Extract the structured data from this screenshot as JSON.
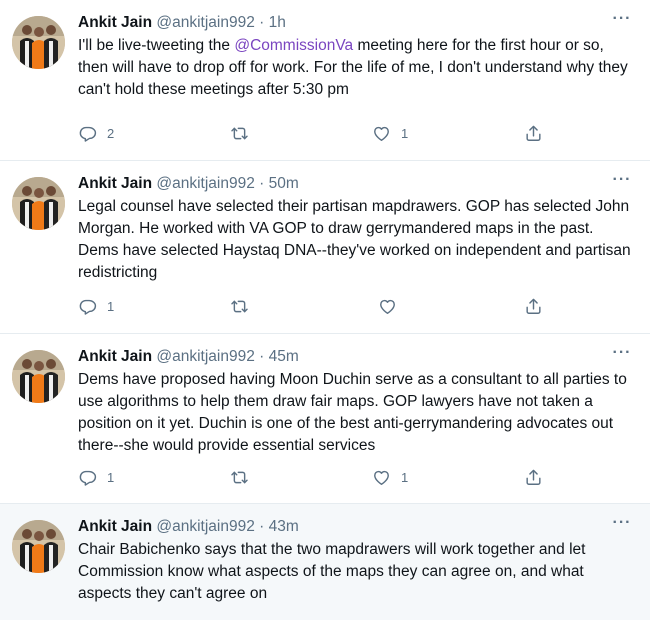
{
  "tweets": [
    {
      "name": "Ankit Jain",
      "handle": "@ankitjain992",
      "separator": "·",
      "time": "1h",
      "text_before": "I'll be live-tweeting the ",
      "mention": "@CommissionVa",
      "text_after": " meeting here for the first hour or so, then will have to drop off for work. For the life of me, I don't understand why they can't hold these meetings after 5:30 pm",
      "replies": "2",
      "retweets": "",
      "likes": "1"
    },
    {
      "name": "Ankit Jain",
      "handle": "@ankitjain992",
      "separator": "·",
      "time": "50m",
      "text": "Legal counsel have selected their partisan mapdrawers. GOP has selected John Morgan. He worked with VA GOP to draw gerrymandered maps in the past. Dems have selected Haystaq DNA--they've worked on independent and partisan redistricting",
      "replies": "1",
      "retweets": "",
      "likes": ""
    },
    {
      "name": "Ankit Jain",
      "handle": "@ankitjain992",
      "separator": "·",
      "time": "45m",
      "text": "Dems have proposed having Moon Duchin serve as a consultant to all parties to use algorithms to help them draw fair maps. GOP lawyers have not taken a position on it yet. Duchin is one of the best anti-gerrymandering advocates out there--she would provide essential services",
      "replies": "1",
      "retweets": "",
      "likes": "1"
    },
    {
      "name": "Ankit Jain",
      "handle": "@ankitjain992",
      "separator": "·",
      "time": "43m",
      "text": "Chair Babichenko says that the two mapdrawers will work together and let Commission know what aspects of the maps they can agree on, and what aspects they can't agree on"
    }
  ],
  "icons": {
    "more": "more-options-icon",
    "reply": "reply-icon",
    "retweet": "retweet-icon",
    "like": "like-icon",
    "share": "share-icon"
  },
  "colors": {
    "mention": "#7a45c0",
    "secondary_text": "#5b7083",
    "highlight_bg": "#f5f8fa"
  }
}
